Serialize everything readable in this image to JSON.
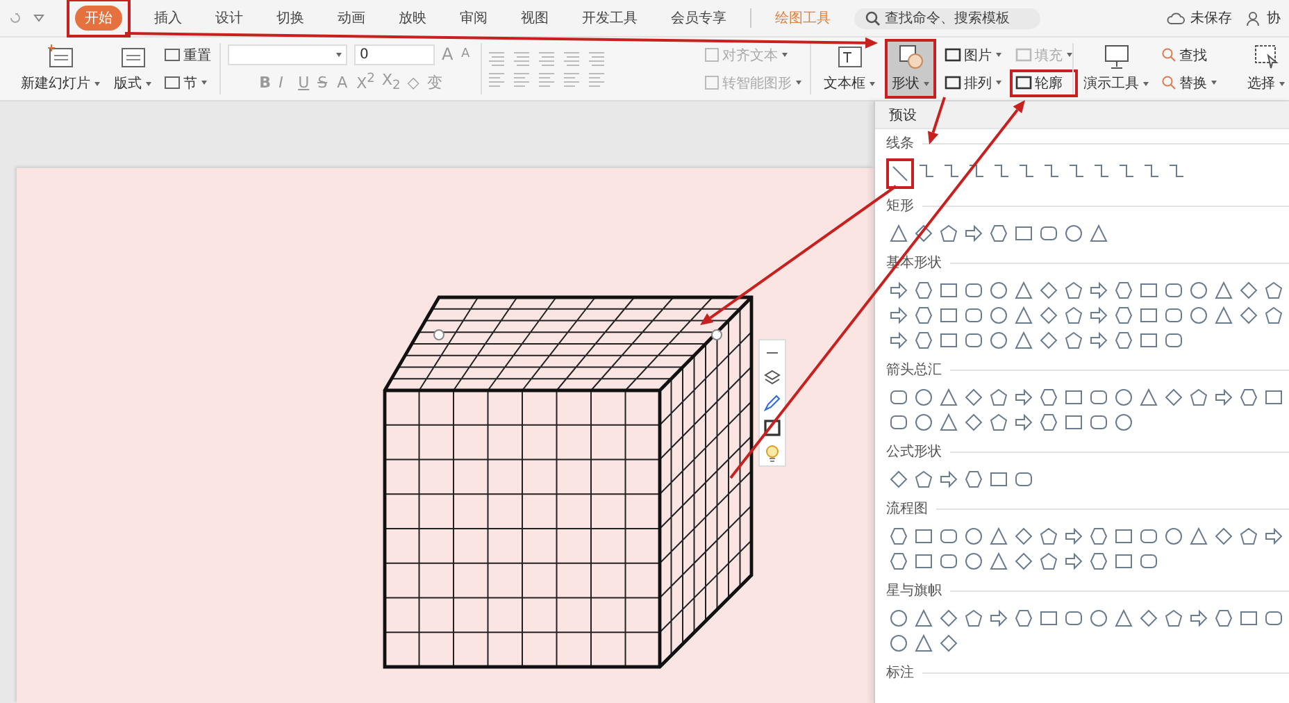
{
  "menu_tabs": [
    {
      "label": "开始",
      "selected": true,
      "highlighted": true
    },
    {
      "label": "插入",
      "selected": false,
      "highlighted": false
    },
    {
      "label": "设计",
      "selected": false,
      "highlighted": false
    },
    {
      "label": "切换",
      "selected": false,
      "highlighted": false
    },
    {
      "label": "动画",
      "selected": false,
      "highlighted": false
    },
    {
      "label": "放映",
      "selected": false,
      "highlighted": false
    },
    {
      "label": "审阅",
      "selected": false,
      "highlighted": false
    },
    {
      "label": "视图",
      "selected": false,
      "highlighted": false
    },
    {
      "label": "开发工具",
      "selected": false,
      "highlighted": false
    },
    {
      "label": "会员专享",
      "selected": false,
      "highlighted": false
    }
  ],
  "context_tab": {
    "label": "绘图工具"
  },
  "search": {
    "placeholder": "查找命令、搜索模板"
  },
  "save_status": "未保存",
  "collab": "协",
  "ribbon": {
    "slide_large": [
      {
        "label": "新建幻灯片",
        "dropdown": true
      },
      {
        "label": "版式",
        "dropdown": true
      }
    ],
    "slide_small": [
      {
        "label": "重置",
        "dropdown": false
      },
      {
        "label": "节",
        "dropdown": true
      }
    ],
    "font_size": "0",
    "size_glyphs": [
      "A",
      "A"
    ],
    "format_glyphs": [
      "B",
      "I",
      "U",
      "S",
      "A",
      "X$^{2}$",
      "X$_{2}$",
      "◇",
      "变"
    ],
    "text_tools": [
      {
        "label": "对齐文本",
        "dropdown": true,
        "disabled": true
      },
      {
        "label": "转智能图形",
        "dropdown": true,
        "disabled": true
      }
    ],
    "draw_large": [
      {
        "label": "文本框",
        "dropdown": true,
        "selected": false,
        "highlighted": false
      },
      {
        "label": "形状",
        "dropdown": true,
        "selected": true,
        "highlighted": true
      }
    ],
    "draw_small": [
      {
        "label": "图片",
        "dropdown": true,
        "disabled": false,
        "highlighted": false
      },
      {
        "label": "填充",
        "dropdown": true,
        "disabled": true,
        "highlighted": false
      },
      {
        "label": "排列",
        "dropdown": true,
        "disabled": false,
        "highlighted": false
      },
      {
        "label": "轮廓",
        "dropdown": false,
        "disabled": false,
        "highlighted": true
      }
    ],
    "show_tool": {
      "label": "演示工具",
      "dropdown": true
    },
    "find_small": [
      {
        "label": "查找",
        "dropdown": false
      },
      {
        "label": "替换",
        "dropdown": true
      }
    ],
    "select_tool": {
      "label": "选择",
      "dropdown": true
    }
  },
  "shapes_panel": {
    "header": "预设",
    "sections": [
      {
        "title": "线条",
        "highlight_first": true
      },
      {
        "title": "矩形",
        "highlight_first": false
      },
      {
        "title": "基本形状",
        "highlight_first": false
      },
      {
        "title": "箭头总汇",
        "highlight_first": false
      },
      {
        "title": "公式形状",
        "highlight_first": false
      },
      {
        "title": "流程图",
        "highlight_first": false
      },
      {
        "title": "星与旗帜",
        "highlight_first": false
      },
      {
        "title": "标注",
        "highlight_first": false
      }
    ]
  }
}
